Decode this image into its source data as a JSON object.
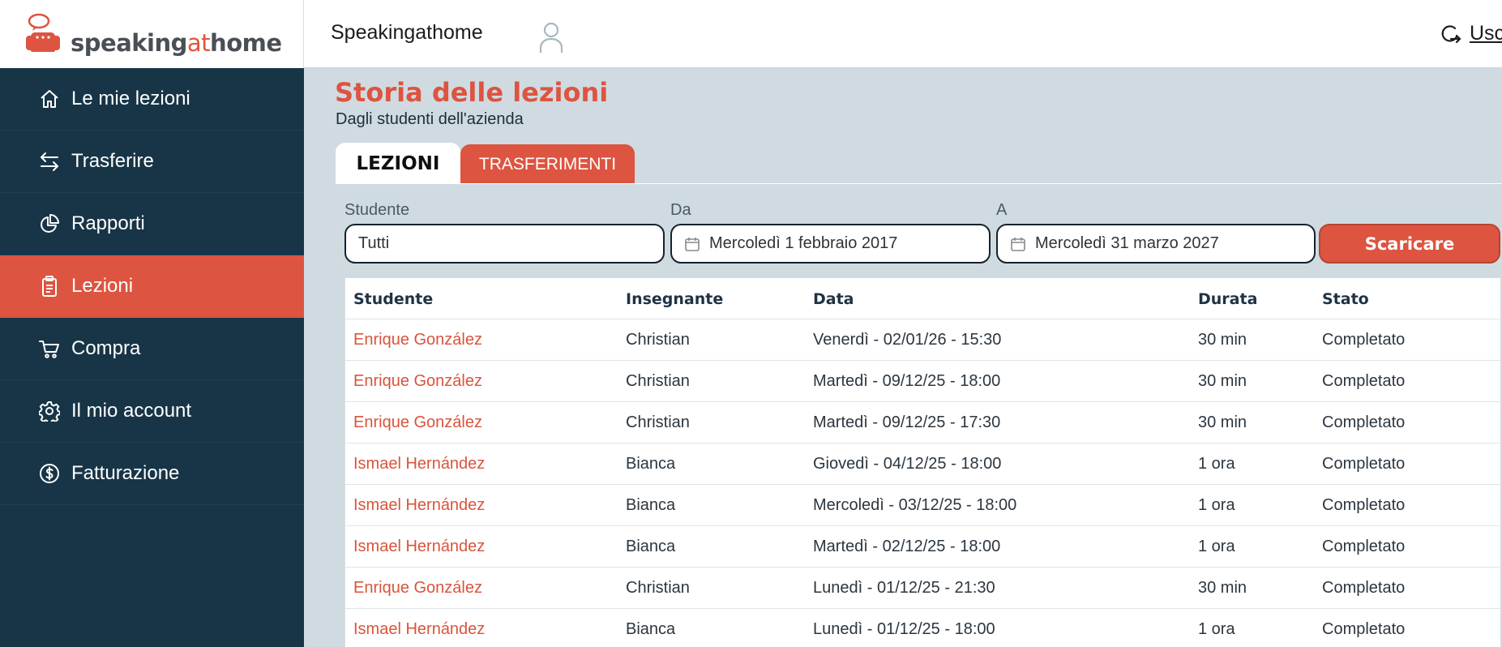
{
  "logo": {
    "part1": "speaking",
    "part2": "at",
    "part3": "home"
  },
  "colors": {
    "accent": "#dd5440",
    "sidebar": "#183547",
    "background": "#cfdbe1"
  },
  "sidebar": {
    "items": [
      {
        "label": "Le mie lezioni",
        "icon": "home-icon"
      },
      {
        "label": "Trasferire",
        "icon": "transfer-arrows-icon"
      },
      {
        "label": "Rapporti",
        "icon": "pie-chart-icon"
      },
      {
        "label": "Lezioni",
        "icon": "clipboard-icon",
        "active": true
      },
      {
        "label": "Compra",
        "icon": "cart-icon"
      },
      {
        "label": "Il mio account",
        "icon": "gear-icon"
      },
      {
        "label": "Fatturazione",
        "icon": "dollar-circle-icon"
      }
    ]
  },
  "header": {
    "brand": "Speakingathome",
    "logout_label": "Uscita"
  },
  "main": {
    "title": "Storia delle lezioni",
    "subtitle": "Dagli studenti dell'azienda",
    "tabs": [
      {
        "label": "LEZIONI"
      },
      {
        "label": "TRASFERIMENTI"
      }
    ]
  },
  "filters": {
    "student_label": "Studente",
    "student_value": "Tutti",
    "from_label": "Da",
    "from_value": "Mercoledì 1 febbraio 2017",
    "to_label": "A",
    "to_value": "Mercoledì 31 marzo 2027",
    "download_label": "Scaricare"
  },
  "table": {
    "columns": [
      "Studente",
      "Insegnante",
      "Data",
      "Durata",
      "Stato"
    ],
    "rows": [
      [
        "Enrique González",
        "Christian",
        "Venerdì - 02/01/26 - 15:30",
        "30 min",
        "Completato"
      ],
      [
        "Enrique González",
        "Christian",
        "Martedì - 09/12/25 - 18:00",
        "30 min",
        "Completato"
      ],
      [
        "Enrique González",
        "Christian",
        "Martedì - 09/12/25 - 17:30",
        "30 min",
        "Completato"
      ],
      [
        "Ismael Hernández",
        "Bianca",
        "Giovedì - 04/12/25 - 18:00",
        "1 ora",
        "Completato"
      ],
      [
        "Ismael Hernández",
        "Bianca",
        "Mercoledì - 03/12/25 - 18:00",
        "1 ora",
        "Completato"
      ],
      [
        "Ismael Hernández",
        "Bianca",
        "Martedì - 02/12/25 - 18:00",
        "1 ora",
        "Completato"
      ],
      [
        "Enrique González",
        "Christian",
        "Lunedì - 01/12/25 - 21:30",
        "30 min",
        "Completato"
      ],
      [
        "Ismael Hernández",
        "Bianca",
        "Lunedì - 01/12/25 - 18:00",
        "1 ora",
        "Completato"
      ]
    ]
  }
}
